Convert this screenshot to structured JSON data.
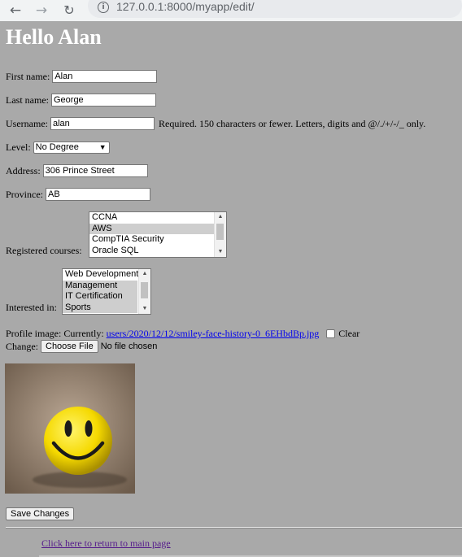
{
  "browser": {
    "url": "127.0.0.1:8000/myapp/edit/",
    "back_icon": "←",
    "forward_icon": "→",
    "reload_icon": "↻",
    "info_icon": "i"
  },
  "page": {
    "title": "Hello Alan"
  },
  "form": {
    "first_name": {
      "label": "First name:",
      "value": "Alan"
    },
    "last_name": {
      "label": "Last name:",
      "value": "George"
    },
    "username": {
      "label": "Username:",
      "value": "alan",
      "help": "Required. 150 characters or fewer. Letters, digits and @/./+/-/_ only."
    },
    "level": {
      "label": "Level:",
      "value": "No Degree"
    },
    "address": {
      "label": "Address:",
      "value": "306 Prince Street"
    },
    "province": {
      "label": "Province:",
      "value": "AB"
    },
    "registered_courses": {
      "label": "Registered courses:",
      "options": [
        "CCNA",
        "AWS",
        "CompTIA Security",
        "Oracle SQL"
      ]
    },
    "interested_in": {
      "label": "Interested in:",
      "options": [
        "Web Development",
        "Management",
        "IT Certification",
        "Sports"
      ]
    },
    "profile_image": {
      "label": "Profile image:",
      "currently_label": "Currently:",
      "current_file": "users/2020/12/12/smiley-face-history-0_6EHbdBp.jpg",
      "clear_label": "Clear",
      "change_label": "Change:",
      "choose_button": "Choose File",
      "no_file": "No file chosen"
    },
    "submit_label": "Save Changes"
  },
  "footer": {
    "return_link": "Click here to return to main page"
  },
  "colors": {
    "page_background": "#a9a9a9",
    "title_color": "#ffffff",
    "link_color": "#0000ee",
    "visited_link_color": "#551a8b"
  }
}
